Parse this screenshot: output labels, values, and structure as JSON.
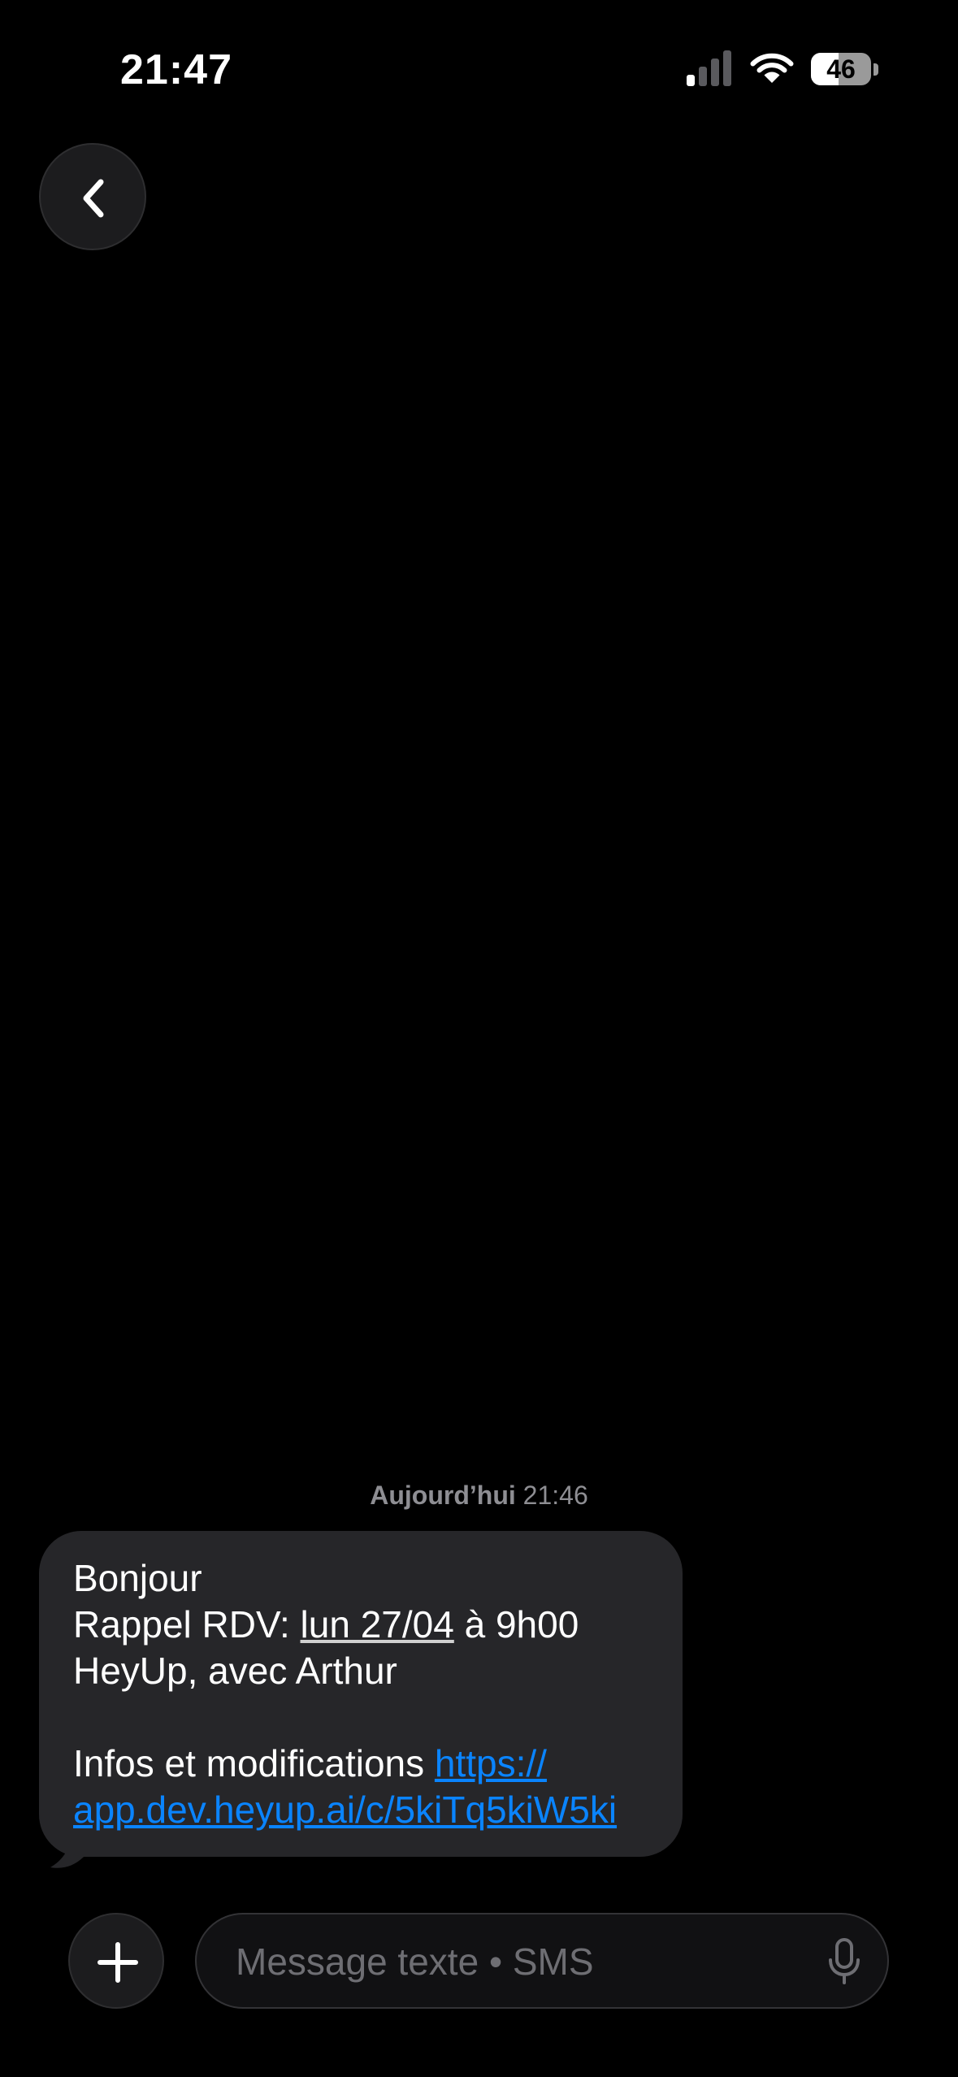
{
  "status_bar": {
    "time": "21:47",
    "battery_level": "46",
    "battery_fraction": 0.46,
    "signal_bars_active": 1,
    "signal_bars_total": 4,
    "icons": [
      "cellular-signal-icon",
      "wifi-icon",
      "battery-icon"
    ]
  },
  "nav": {
    "back_icon": "chevron-left-icon"
  },
  "thread": {
    "day": "Aujourd’hui",
    "time": "21:46"
  },
  "message": {
    "greeting": "Bonjour",
    "reminder_prefix": "Rappel RDV: ",
    "reminder_date": "lun 27/04",
    "reminder_time": " à 9h00",
    "company_line": "HeyUp, avec Arthur",
    "info_prefix": "Infos et modifications ",
    "link_part1": "https://",
    "link_part2": "app.dev.heyup.ai/c/5kiTq5kiW5ki"
  },
  "composer": {
    "add_icon": "plus-icon",
    "placeholder": "Message texte • SMS",
    "value": "",
    "mic_icon": "microphone-icon"
  },
  "colors": {
    "background": "#000000",
    "bubble": "#262629",
    "link": "#0a84ff",
    "secondary_text": "#8e8e93"
  }
}
